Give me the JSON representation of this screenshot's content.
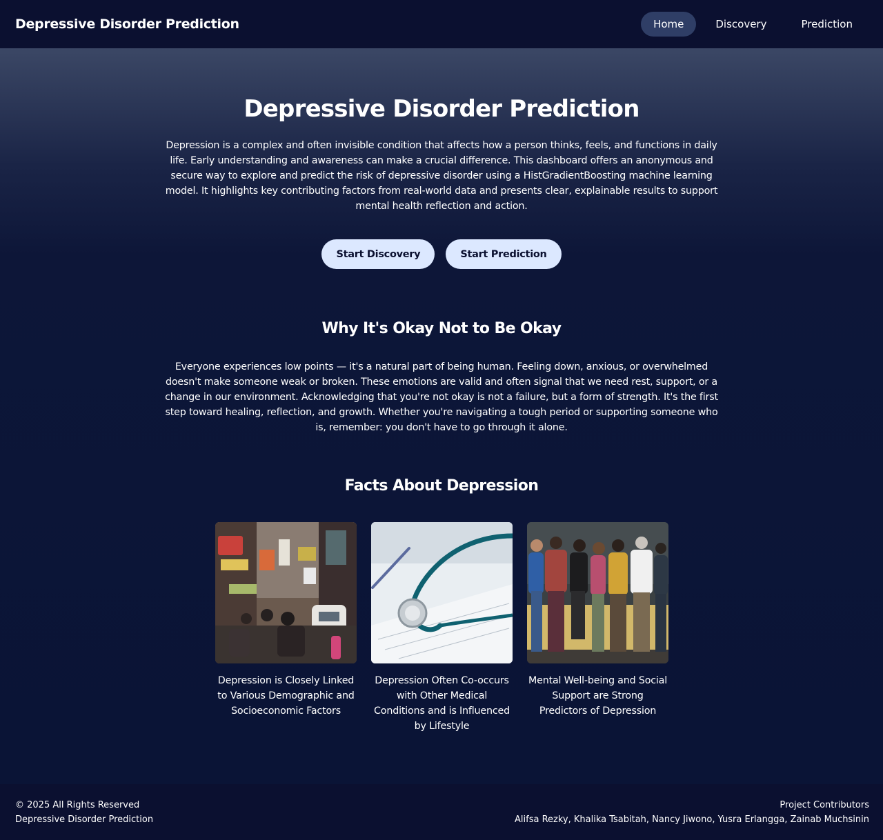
{
  "navbar": {
    "brand": "Depressive Disorder Prediction",
    "links": [
      {
        "label": "Home",
        "active": true
      },
      {
        "label": "Discovery",
        "active": false
      },
      {
        "label": "Prediction",
        "active": false
      }
    ]
  },
  "hero": {
    "title": "Depressive Disorder Prediction",
    "description": "Depression is a complex and often invisible condition that affects how a person thinks, feels, and functions in daily life. Early understanding and awareness can make a crucial difference. This dashboard offers an anonymous and secure way to explore and predict the risk of depressive disorder using a HistGradientBoosting machine learning model. It highlights key contributing factors from real-world data and presents clear, explainable results to support mental health reflection and action.",
    "buttons": [
      "Start Discovery",
      "Start Prediction"
    ]
  },
  "okay_section": {
    "title": "Why It's Okay Not to Be Okay",
    "text": "Everyone experiences low points — it's a natural part of being human. Feeling down, anxious, or overwhelmed doesn't make someone weak or broken. These emotions are valid and often signal that we need rest, support, or a change in our environment. Acknowledging that you're not okay is not a failure, but a form of strength. It's the first step toward healing, reflection, and growth. Whether you're navigating a tough period or supporting someone who is, remember: you don't have to go through it alone."
  },
  "facts": {
    "title": "Facts About Depression",
    "cards": [
      {
        "image": "busy-street-photo",
        "caption": "Depression is Closely Linked to Various Demographic and Socioeconomic Factors"
      },
      {
        "image": "stethoscope-photo",
        "caption": "Depression Often Co-occurs with Other Medical Conditions and is Influenced by Lifestyle"
      },
      {
        "image": "group-embrace-photo",
        "caption": "Mental Well-being and Social Support are Strong Predictors of Depression"
      }
    ]
  },
  "footer": {
    "copyright": "© 2025 All Rights Reserved",
    "site_name": "Depressive Disorder Prediction",
    "contributors_label": "Project Contributors",
    "contributors": "Alifsa Rezky, Khalika Tsabitah, Nancy Jiwono, Yusra Erlangga, Zainab Muchsinin"
  }
}
